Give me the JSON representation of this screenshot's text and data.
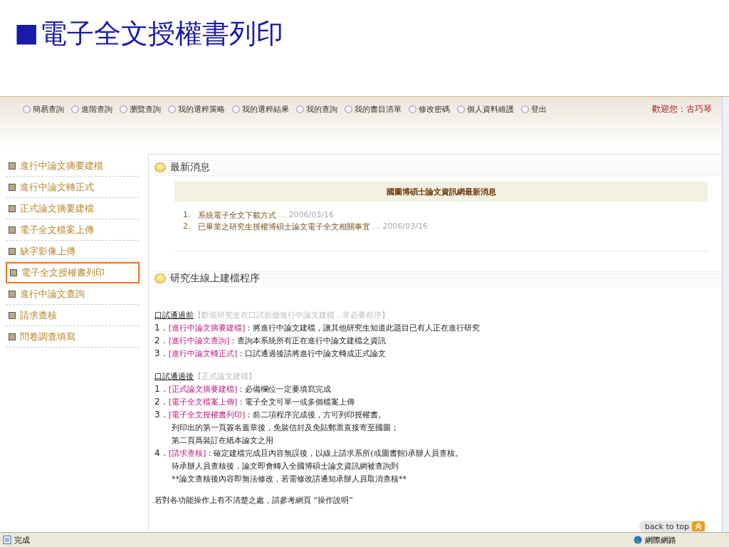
{
  "slide_title": {
    "bullet": "■",
    "text": "電子全文授權書列印"
  },
  "nav": {
    "items": [
      "簡易查詢",
      "進階查詢",
      "瀏覽查詢",
      "我的選粹策略",
      "我的選粹結果",
      "我的查詢",
      "我的書目清單",
      "修改密碼",
      "個人資料維護",
      "登出"
    ],
    "welcome": "歡迎您：古巧琴"
  },
  "sidebar": {
    "items": [
      {
        "label": "進行中論文摘要建檔",
        "selected": false
      },
      {
        "label": "進行中論文轉正式",
        "selected": false
      },
      {
        "label": "正式論文摘要建檔",
        "selected": false
      },
      {
        "label": "電子全文檔案上傳",
        "selected": false
      },
      {
        "label": "缺字影像上傳",
        "selected": false
      },
      {
        "label": "電子全文授權書列印",
        "selected": true
      },
      {
        "label": "進行中論文查詢",
        "selected": false
      },
      {
        "label": "請求查核",
        "selected": false
      },
      {
        "label": "問卷調查填寫",
        "selected": false
      }
    ]
  },
  "news": {
    "heading": "最新消息",
    "banner": "國圖博碩士論文資訊網最新消息",
    "items": [
      {
        "number": "1.",
        "title": "系統電子全文下載方式",
        "date": "... 2006/03/16"
      },
      {
        "number": "2.",
        "title": "已畢業之研究生授權博碩士論文電子全文相關事宜",
        "date": "... 2006/03/16"
      }
    ]
  },
  "procedure": {
    "heading": "研究生線上建檔程序",
    "groups": [
      {
        "title": "口試通過前",
        "note": "【歡迎研究生在口試前做進行中論文建檔，非必要程序】",
        "steps": [
          {
            "number": "1．",
            "link": "[進行中論文摘要建檔]",
            "text": "：將進行中論文建檔，讓其他研究生知道此題目已有人正在進行研究"
          },
          {
            "number": "2．",
            "link": "[進行中論文查詢]",
            "text": "：查詢本系統所有正在進行中論文建檔之資訊"
          },
          {
            "number": "3．",
            "link": "[進行中論文轉正式]",
            "text": "：口試通過後請將進行中論文轉成正式論文"
          }
        ]
      },
      {
        "title": "口試通過後",
        "note": "【正式論文建檔】",
        "steps": [
          {
            "number": "1．",
            "link": "[正式論文摘要建檔]",
            "text": "：必備欄位一定要填寫完成"
          },
          {
            "number": "2．",
            "link": "[電子全文檔案上傳]",
            "text": "：電子全文可單一或多個檔案上傳"
          },
          {
            "number": "3．",
            "link": "[電子全文授權書列印]",
            "text": "：前二項程序完成後，方可列印授權書。",
            "extra": [
              "列印出的第一頁簽名蓋章後，免裝信封及免貼郵票直接寄至國圖；",
              "第二頁爲裝訂在紙本論文之用"
            ]
          },
          {
            "number": "4．",
            "link": "[請求查核]",
            "text": "：確定建檔完成且內容無誤後，以線上請求系所(或圖書館)承辦人員查核。",
            "extra": [
              "待承辦人員查核後，論文即會轉入全國博碩士論文資訊網被查詢到",
              "**論文查核後內容即無法修改，若需修改請通知承辦人員取消查核**"
            ]
          }
        ]
      }
    ],
    "footer": "若對各功能操作上有不清楚之處，請參考網頁 “操作說明”"
  },
  "back_to_top": "back to top",
  "status_bar": {
    "status": "完成",
    "zone": "網際網路"
  }
}
